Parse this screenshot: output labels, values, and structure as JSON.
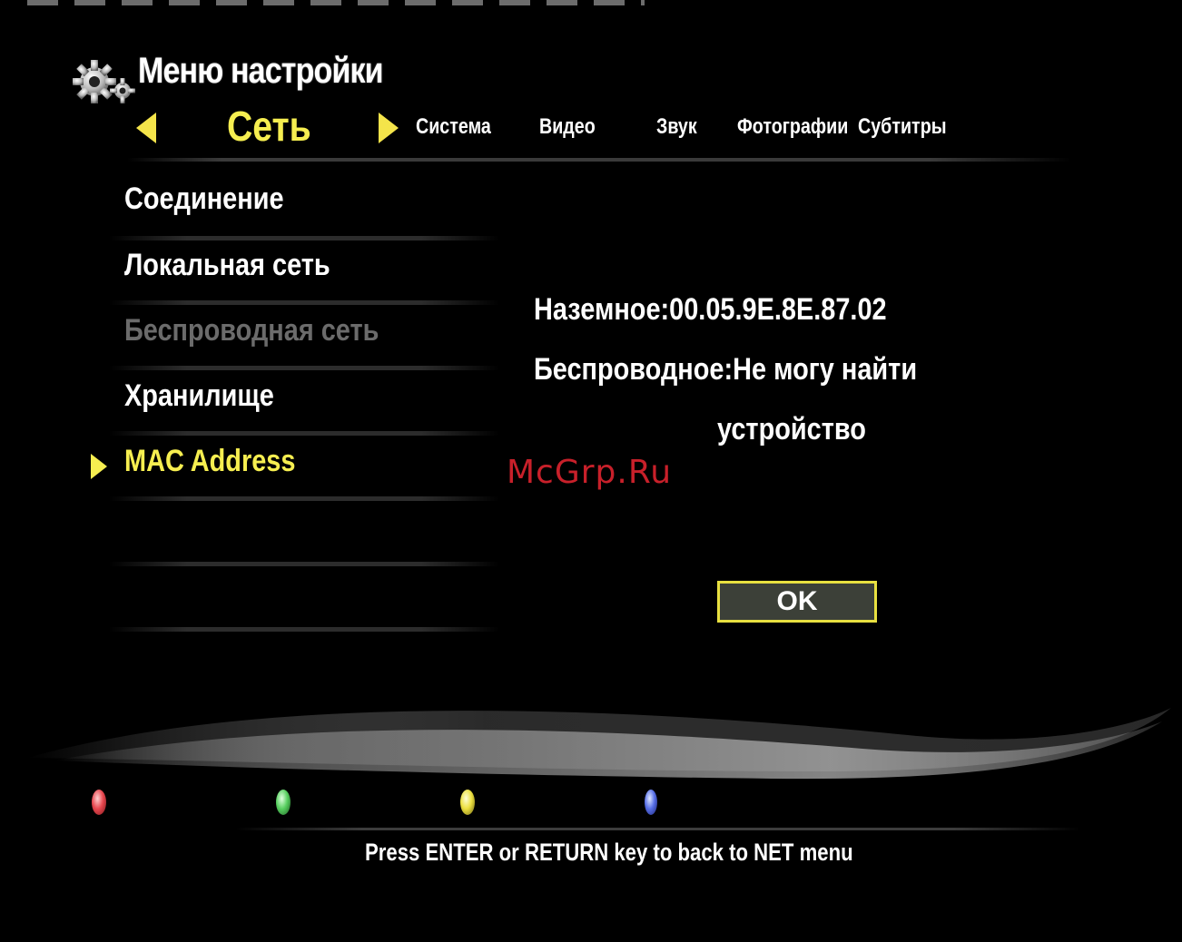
{
  "header": {
    "title": "Меню настройки",
    "gear_icon": "gear-icon"
  },
  "tabs": {
    "active": "Сеть",
    "items": [
      "Система",
      "Видео",
      "Звук",
      "Фотографии",
      "Субтитры"
    ]
  },
  "menu": {
    "items": [
      {
        "label": "Соединение",
        "state": "normal"
      },
      {
        "label": "Локальная сеть",
        "state": "normal"
      },
      {
        "label": "Беспроводная сеть",
        "state": "disabled"
      },
      {
        "label": "Хранилище",
        "state": "normal"
      },
      {
        "label": "MAC Address",
        "state": "selected"
      }
    ]
  },
  "mac_info": {
    "wired": "Наземное:00.05.9E.8E.87.02",
    "wireless_line1": "Беспроводное:Не могу найти",
    "wireless_line2": "устройство"
  },
  "dialog": {
    "ok_label": "OK"
  },
  "watermark": "McGrp.Ru",
  "color_buttons": [
    "red",
    "green",
    "yellow",
    "blue"
  ],
  "footer": {
    "hint": "Press ENTER or RETURN key to back to NET menu"
  },
  "colors": {
    "accent_yellow": "#f6ee50",
    "disabled_gray": "#6b6b6b",
    "watermark_red": "#c8202a",
    "background": "#000000"
  }
}
